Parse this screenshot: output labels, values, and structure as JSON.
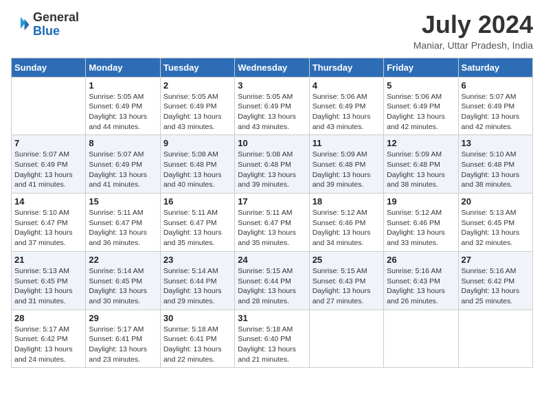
{
  "header": {
    "logo_general": "General",
    "logo_blue": "Blue",
    "month_year": "July 2024",
    "location": "Maniar, Uttar Pradesh, India"
  },
  "days_of_week": [
    "Sunday",
    "Monday",
    "Tuesday",
    "Wednesday",
    "Thursday",
    "Friday",
    "Saturday"
  ],
  "weeks": [
    [
      {
        "day": "",
        "sunrise": "",
        "sunset": "",
        "daylight": ""
      },
      {
        "day": "1",
        "sunrise": "Sunrise: 5:05 AM",
        "sunset": "Sunset: 6:49 PM",
        "daylight": "Daylight: 13 hours and 44 minutes."
      },
      {
        "day": "2",
        "sunrise": "Sunrise: 5:05 AM",
        "sunset": "Sunset: 6:49 PM",
        "daylight": "Daylight: 13 hours and 43 minutes."
      },
      {
        "day": "3",
        "sunrise": "Sunrise: 5:05 AM",
        "sunset": "Sunset: 6:49 PM",
        "daylight": "Daylight: 13 hours and 43 minutes."
      },
      {
        "day": "4",
        "sunrise": "Sunrise: 5:06 AM",
        "sunset": "Sunset: 6:49 PM",
        "daylight": "Daylight: 13 hours and 43 minutes."
      },
      {
        "day": "5",
        "sunrise": "Sunrise: 5:06 AM",
        "sunset": "Sunset: 6:49 PM",
        "daylight": "Daylight: 13 hours and 42 minutes."
      },
      {
        "day": "6",
        "sunrise": "Sunrise: 5:07 AM",
        "sunset": "Sunset: 6:49 PM",
        "daylight": "Daylight: 13 hours and 42 minutes."
      }
    ],
    [
      {
        "day": "7",
        "sunrise": "Sunrise: 5:07 AM",
        "sunset": "Sunset: 6:49 PM",
        "daylight": "Daylight: 13 hours and 41 minutes."
      },
      {
        "day": "8",
        "sunrise": "Sunrise: 5:07 AM",
        "sunset": "Sunset: 6:49 PM",
        "daylight": "Daylight: 13 hours and 41 minutes."
      },
      {
        "day": "9",
        "sunrise": "Sunrise: 5:08 AM",
        "sunset": "Sunset: 6:48 PM",
        "daylight": "Daylight: 13 hours and 40 minutes."
      },
      {
        "day": "10",
        "sunrise": "Sunrise: 5:08 AM",
        "sunset": "Sunset: 6:48 PM",
        "daylight": "Daylight: 13 hours and 39 minutes."
      },
      {
        "day": "11",
        "sunrise": "Sunrise: 5:09 AM",
        "sunset": "Sunset: 6:48 PM",
        "daylight": "Daylight: 13 hours and 39 minutes."
      },
      {
        "day": "12",
        "sunrise": "Sunrise: 5:09 AM",
        "sunset": "Sunset: 6:48 PM",
        "daylight": "Daylight: 13 hours and 38 minutes."
      },
      {
        "day": "13",
        "sunrise": "Sunrise: 5:10 AM",
        "sunset": "Sunset: 6:48 PM",
        "daylight": "Daylight: 13 hours and 38 minutes."
      }
    ],
    [
      {
        "day": "14",
        "sunrise": "Sunrise: 5:10 AM",
        "sunset": "Sunset: 6:47 PM",
        "daylight": "Daylight: 13 hours and 37 minutes."
      },
      {
        "day": "15",
        "sunrise": "Sunrise: 5:11 AM",
        "sunset": "Sunset: 6:47 PM",
        "daylight": "Daylight: 13 hours and 36 minutes."
      },
      {
        "day": "16",
        "sunrise": "Sunrise: 5:11 AM",
        "sunset": "Sunset: 6:47 PM",
        "daylight": "Daylight: 13 hours and 35 minutes."
      },
      {
        "day": "17",
        "sunrise": "Sunrise: 5:11 AM",
        "sunset": "Sunset: 6:47 PM",
        "daylight": "Daylight: 13 hours and 35 minutes."
      },
      {
        "day": "18",
        "sunrise": "Sunrise: 5:12 AM",
        "sunset": "Sunset: 6:46 PM",
        "daylight": "Daylight: 13 hours and 34 minutes."
      },
      {
        "day": "19",
        "sunrise": "Sunrise: 5:12 AM",
        "sunset": "Sunset: 6:46 PM",
        "daylight": "Daylight: 13 hours and 33 minutes."
      },
      {
        "day": "20",
        "sunrise": "Sunrise: 5:13 AM",
        "sunset": "Sunset: 6:45 PM",
        "daylight": "Daylight: 13 hours and 32 minutes."
      }
    ],
    [
      {
        "day": "21",
        "sunrise": "Sunrise: 5:13 AM",
        "sunset": "Sunset: 6:45 PM",
        "daylight": "Daylight: 13 hours and 31 minutes."
      },
      {
        "day": "22",
        "sunrise": "Sunrise: 5:14 AM",
        "sunset": "Sunset: 6:45 PM",
        "daylight": "Daylight: 13 hours and 30 minutes."
      },
      {
        "day": "23",
        "sunrise": "Sunrise: 5:14 AM",
        "sunset": "Sunset: 6:44 PM",
        "daylight": "Daylight: 13 hours and 29 minutes."
      },
      {
        "day": "24",
        "sunrise": "Sunrise: 5:15 AM",
        "sunset": "Sunset: 6:44 PM",
        "daylight": "Daylight: 13 hours and 28 minutes."
      },
      {
        "day": "25",
        "sunrise": "Sunrise: 5:15 AM",
        "sunset": "Sunset: 6:43 PM",
        "daylight": "Daylight: 13 hours and 27 minutes."
      },
      {
        "day": "26",
        "sunrise": "Sunrise: 5:16 AM",
        "sunset": "Sunset: 6:43 PM",
        "daylight": "Daylight: 13 hours and 26 minutes."
      },
      {
        "day": "27",
        "sunrise": "Sunrise: 5:16 AM",
        "sunset": "Sunset: 6:42 PM",
        "daylight": "Daylight: 13 hours and 25 minutes."
      }
    ],
    [
      {
        "day": "28",
        "sunrise": "Sunrise: 5:17 AM",
        "sunset": "Sunset: 6:42 PM",
        "daylight": "Daylight: 13 hours and 24 minutes."
      },
      {
        "day": "29",
        "sunrise": "Sunrise: 5:17 AM",
        "sunset": "Sunset: 6:41 PM",
        "daylight": "Daylight: 13 hours and 23 minutes."
      },
      {
        "day": "30",
        "sunrise": "Sunrise: 5:18 AM",
        "sunset": "Sunset: 6:41 PM",
        "daylight": "Daylight: 13 hours and 22 minutes."
      },
      {
        "day": "31",
        "sunrise": "Sunrise: 5:18 AM",
        "sunset": "Sunset: 6:40 PM",
        "daylight": "Daylight: 13 hours and 21 minutes."
      },
      {
        "day": "",
        "sunrise": "",
        "sunset": "",
        "daylight": ""
      },
      {
        "day": "",
        "sunrise": "",
        "sunset": "",
        "daylight": ""
      },
      {
        "day": "",
        "sunrise": "",
        "sunset": "",
        "daylight": ""
      }
    ]
  ]
}
